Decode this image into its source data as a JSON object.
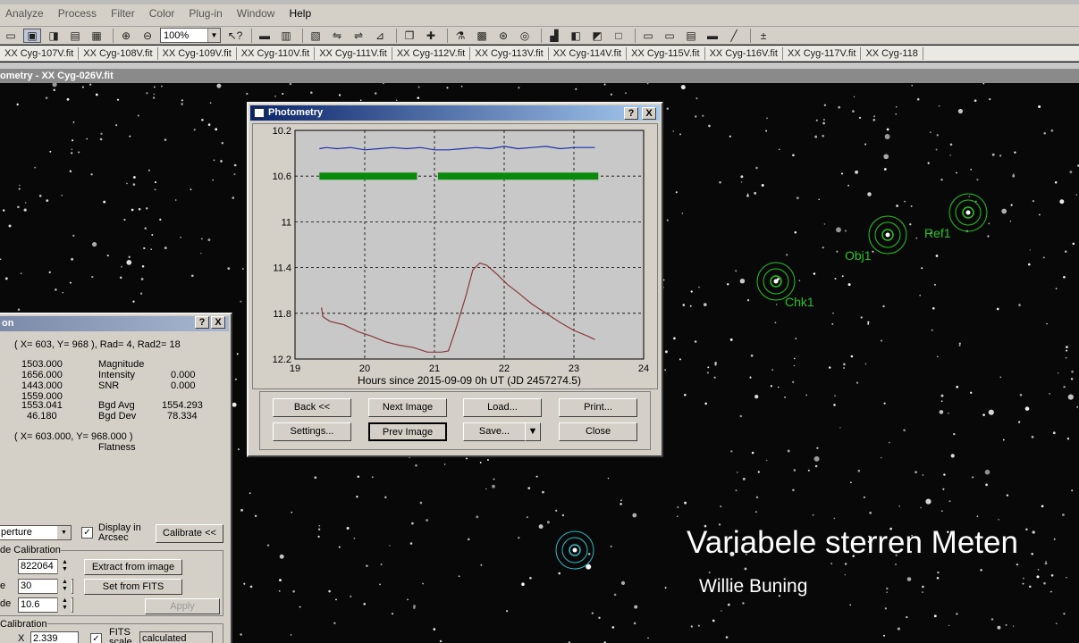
{
  "menu": {
    "items": [
      "Analyze",
      "Process",
      "Filter",
      "Color",
      "Plug-in",
      "Window",
      "Help"
    ]
  },
  "toolbar": {
    "zoom_value": "100%"
  },
  "file_tabs": [
    "XX Cyg-107V.fit",
    "XX Cyg-108V.fit",
    "XX Cyg-109V.fit",
    "XX Cyg-110V.fit",
    "XX Cyg-111V.fit",
    "XX Cyg-112V.fit",
    "XX Cyg-113V.fit",
    "XX Cyg-114V.fit",
    "XX Cyg-115V.fit",
    "XX Cyg-116V.fit",
    "XX Cyg-117V.fit",
    "XX Cyg-118"
  ],
  "child_window": {
    "title": "ometry - XX Cyg-026V.fit"
  },
  "overlay": {
    "title": "Variabele sterren Meten",
    "author": "Willie Buning"
  },
  "star_labels": {
    "ref": "Ref1",
    "obj": "Obj1",
    "chk": "Chk1"
  },
  "photometry_dialog": {
    "title": "Photometry",
    "help_btn": "?",
    "close_btn": "X",
    "buttons": {
      "back": "Back <<",
      "next_image": "Next Image",
      "load": "Load...",
      "print": "Print...",
      "settings": "Settings...",
      "prev_image": "Prev Image",
      "save": "Save...",
      "close": "Close"
    }
  },
  "chart_data": {
    "type": "line",
    "xlabel": "Hours since 2015-09-09 0h UT (JD 2457274.5)",
    "ylabel": "",
    "xlim": [
      19,
      24
    ],
    "ylim": [
      12.2,
      10.2
    ],
    "y_reversed": true,
    "grid": true,
    "x_ticks": [
      "19",
      "20",
      "21",
      "22",
      "23",
      "24"
    ],
    "y_ticks": [
      "10.2",
      "10.6",
      "11",
      "11.4",
      "11.8",
      "12.2"
    ],
    "series": [
      {
        "color": "#1f2fa8",
        "x": [
          19.35,
          19.45,
          19.6,
          19.8,
          20.0,
          20.2,
          20.4,
          20.6,
          20.8,
          21.0,
          21.2,
          21.4,
          21.6,
          21.8,
          22.0,
          22.2,
          22.4,
          22.6,
          22.8,
          23.0,
          23.3
        ],
        "y": [
          10.36,
          10.35,
          10.36,
          10.35,
          10.37,
          10.36,
          10.35,
          10.36,
          10.35,
          10.37,
          10.37,
          10.36,
          10.35,
          10.36,
          10.34,
          10.36,
          10.35,
          10.34,
          10.36,
          10.35,
          10.35
        ]
      },
      {
        "color": "#0a8a0a",
        "x": [
          19.35,
          20.75,
          21.05,
          23.35
        ],
        "y": [
          10.6,
          10.6,
          10.6,
          10.6
        ]
      },
      {
        "color": "#8a3a3a",
        "x": [
          19.38,
          19.4,
          19.5,
          19.7,
          19.9,
          20.1,
          20.3,
          20.5,
          20.7,
          20.9,
          21.1,
          21.2,
          21.3,
          21.45,
          21.55,
          21.65,
          21.75,
          21.9,
          22.05,
          22.2,
          22.4,
          22.6,
          22.8,
          23.0,
          23.2,
          23.3
        ],
        "y": [
          11.75,
          11.83,
          11.87,
          11.9,
          11.96,
          12.0,
          12.05,
          12.08,
          12.1,
          12.14,
          12.14,
          12.13,
          11.95,
          11.65,
          11.42,
          11.36,
          11.38,
          11.46,
          11.55,
          11.62,
          11.72,
          11.8,
          11.88,
          11.95,
          12.0,
          12.03
        ]
      }
    ]
  },
  "left_panel": {
    "title": "on",
    "help_btn": "?",
    "close_btn": "X",
    "coord_line": "( X=  603, Y=  968 ), Rad=  4, Rad2= 18",
    "values_col1": [
      "1503.000",
      "1656.000",
      "1443.000",
      "1559.000",
      "1553.041",
      "46.180"
    ],
    "labels_col2": [
      "Magnitude",
      "Intensity",
      "SNR",
      "",
      "Bgd Avg",
      "Bgd Dev"
    ],
    "values_col3": [
      "",
      "0.000",
      "0.000",
      "",
      "1554.293",
      "78.334"
    ],
    "coord_line2": "( X=  603.000, Y=  968.000 )",
    "flatness": "Flatness",
    "mode_select": "perture",
    "display_arcsec": "Display in Arcsec",
    "calibrate_btn": "Calibrate <<",
    "group1_label": "de Calibration",
    "field1_value": "822064",
    "extract_btn": "Extract from image",
    "field2_label": "e",
    "field2_value": "30",
    "set_fits_btn": "Set from FITS",
    "field3_label": "de",
    "field3_value": "10.6",
    "apply_btn": "Apply",
    "group2_label": "Calibration",
    "x_label": "X",
    "x_value": "2.339",
    "fits_scale": "FITS scale",
    "calculated": "calculated"
  }
}
